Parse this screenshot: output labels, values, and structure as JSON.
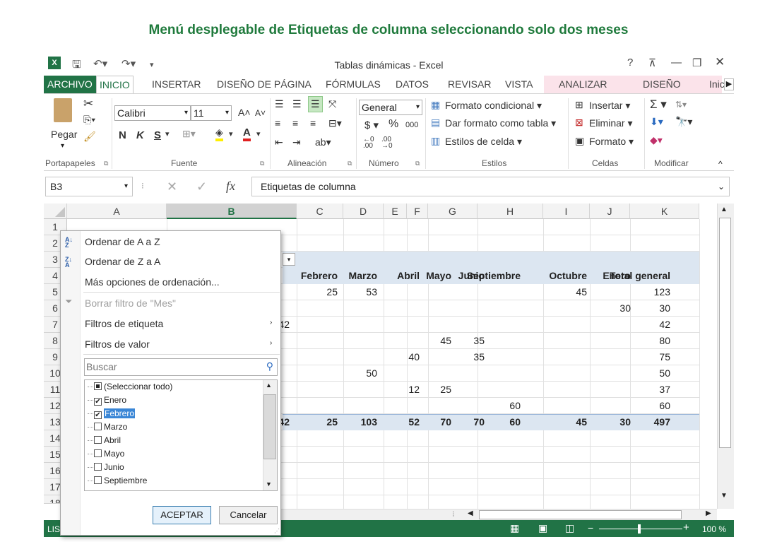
{
  "caption": "Menú desplegable de Etiquetas de columna seleccionando solo dos meses",
  "window": {
    "title": "Tablas dinámicas - Excel",
    "help": "?"
  },
  "tabs": [
    "ARCHIVO",
    "INICIO",
    "INSERTAR",
    "DISEÑO DE PÁGINA",
    "FÓRMULAS",
    "DATOS",
    "REVISAR",
    "VISTA",
    "ANALIZAR",
    "DISEÑO",
    "Inic"
  ],
  "ribbon": {
    "portapapeles": {
      "label": "Portapapeles",
      "pegar": "Pegar"
    },
    "fuente": {
      "label": "Fuente",
      "font": "Calibri",
      "size": "11",
      "bold": "N",
      "italic": "K",
      "underline": "S"
    },
    "alineacion": {
      "label": "Alineación"
    },
    "numero": {
      "label": "Número",
      "format": "General",
      "pct": "%",
      "thousands": "000"
    },
    "estilos": {
      "label": "Estilos",
      "formato_condicional": "Formato condicional",
      "dar_formato": "Dar formato como tabla",
      "estilos_celda": "Estilos de celda"
    },
    "celdas": {
      "label": "Celdas",
      "insertar": "Insertar",
      "eliminar": "Eliminar",
      "formato": "Formato"
    },
    "modificar": {
      "label": "Modificar"
    }
  },
  "formula_bar": {
    "name_box": "B3",
    "fx": "fx",
    "content": "Etiquetas de columna"
  },
  "grid": {
    "columns": [
      "A",
      "B",
      "C",
      "D",
      "E",
      "F",
      "G",
      "H",
      "I",
      "J",
      "K"
    ],
    "rows": [
      "1",
      "2",
      "3",
      "4",
      "5",
      "6",
      "7",
      "8",
      "9",
      "10",
      "11",
      "12",
      "13",
      "14",
      "15",
      "16",
      "17",
      "18"
    ],
    "header_row": [
      "Febrero",
      "Marzo",
      "Abril",
      "Mayo",
      "Junio",
      "Septiembre",
      "Octubre",
      "Enero",
      "Total general"
    ],
    "data": [
      [
        "",
        "25",
        "53",
        "",
        "",
        "",
        "",
        "45",
        "",
        "123"
      ],
      [
        "",
        "",
        "",
        "",
        "",
        "",
        "",
        "",
        "30",
        "30"
      ],
      [
        "42",
        "",
        "",
        "",
        "",
        "",
        "",
        "",
        "",
        "42"
      ],
      [
        "",
        "",
        "",
        "",
        "45",
        "35",
        "",
        "",
        "",
        "80"
      ],
      [
        "",
        "",
        "",
        "40",
        "",
        "35",
        "",
        "",
        "",
        "75"
      ],
      [
        "",
        "",
        "50",
        "",
        "",
        "",
        "",
        "",
        "",
        "50"
      ],
      [
        "",
        "",
        "",
        "12",
        "25",
        "",
        "",
        "",
        "",
        "37"
      ],
      [
        "",
        "",
        "",
        "",
        "",
        "",
        "60",
        "",
        "",
        "60"
      ]
    ],
    "total_row": [
      "42",
      "25",
      "103",
      "52",
      "70",
      "70",
      "60",
      "45",
      "30",
      "497"
    ]
  },
  "status": {
    "mode": "LIS",
    "zoom": "100 %"
  },
  "dropdown": {
    "sort_az": "Ordenar de A a Z",
    "sort_za": "Ordenar de Z a A",
    "more_sort": "Más opciones de ordenación...",
    "clear_filter": "Borrar filtro de \"Mes\"",
    "label_filters": "Filtros de etiqueta",
    "value_filters": "Filtros de valor",
    "search_placeholder": "Buscar",
    "items": [
      {
        "label": "(Seleccionar todo)",
        "state": "partial"
      },
      {
        "label": "Enero",
        "state": "checked"
      },
      {
        "label": "Febrero",
        "state": "checked"
      },
      {
        "label": "Marzo",
        "state": "unchecked"
      },
      {
        "label": "Abril",
        "state": "unchecked"
      },
      {
        "label": "Mayo",
        "state": "unchecked"
      },
      {
        "label": "Junio",
        "state": "unchecked"
      },
      {
        "label": "Septiembre",
        "state": "unchecked"
      }
    ],
    "ok": "ACEPTAR",
    "cancel": "Cancelar"
  },
  "colors": {
    "excel_green": "#217346",
    "pivot_header": "#dce6f1",
    "caption": "#1f7a3c"
  }
}
